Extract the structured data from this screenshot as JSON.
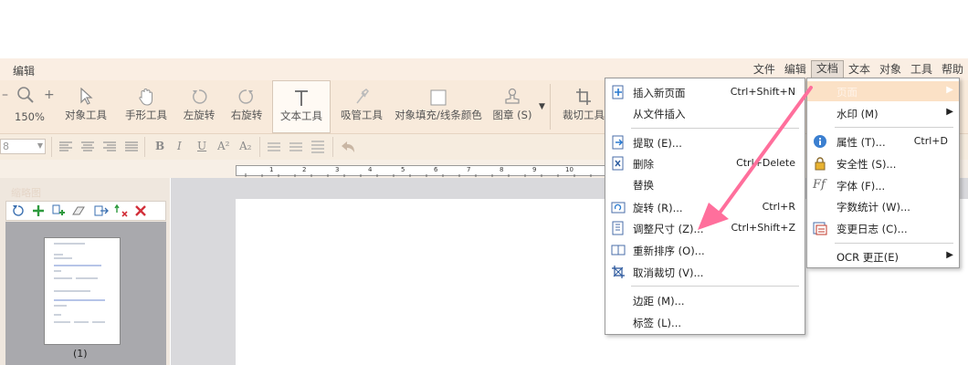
{
  "app": {
    "title": "编辑"
  },
  "menubar": {
    "items": [
      "文件",
      "编辑",
      "文档",
      "文本",
      "对象",
      "工具",
      "帮助"
    ],
    "active_index": 2
  },
  "ribbon": {
    "zoom_minus": "–",
    "zoom_plus": "+",
    "zoom_level": "150%",
    "tools": [
      "对象工具",
      "手形工具",
      "左旋转",
      "右旋转",
      "文本工具",
      "吸管工具",
      "对象填充/线条颜色",
      "图章 (S)",
      "裁切工具"
    ]
  },
  "format": {
    "font_size": "8",
    "bold": "B",
    "italic": "I",
    "underline": "U",
    "superscript": "A²",
    "subscript": "A₂"
  },
  "ruler": {
    "labels": [
      "1",
      "2",
      "3",
      "4",
      "5",
      "6",
      "7",
      "8",
      "9",
      "10"
    ]
  },
  "thumbnails": {
    "title": "缩略图",
    "page_label": "(1)"
  },
  "document_menu": {
    "items": [
      {
        "label": "插入新页面",
        "shortcut": "Ctrl+Shift+N",
        "icon": "insert-page-icon"
      },
      {
        "label": "从文件插入",
        "shortcut": "",
        "icon": ""
      },
      {
        "label": "提取 (E)...",
        "shortcut": "",
        "icon": "extract-icon"
      },
      {
        "label": "删除",
        "shortcut": "Ctrl+Delete",
        "icon": "delete-page-icon"
      },
      {
        "label": "替换",
        "shortcut": "",
        "icon": ""
      },
      {
        "label": "旋转 (R)...",
        "shortcut": "Ctrl+R",
        "icon": "rotate-page-icon"
      },
      {
        "label": "调整尺寸 (Z)...",
        "shortcut": "Ctrl+Shift+Z",
        "icon": "resize-icon"
      },
      {
        "label": "重新排序 (O)...",
        "shortcut": "",
        "icon": "reorder-icon"
      },
      {
        "label": "取消裁切 (V)...",
        "shortcut": "",
        "icon": "uncrop-icon"
      },
      {
        "label": "边距 (M)...",
        "shortcut": "",
        "icon": ""
      },
      {
        "label": "标签 (L)...",
        "shortcut": "",
        "icon": ""
      }
    ]
  },
  "submenu": {
    "items": [
      {
        "label": "页面",
        "shortcut": "",
        "arrow": "▶",
        "highlighted": true
      },
      {
        "label": "水印 (M)",
        "shortcut": "",
        "arrow": "▶"
      },
      {
        "label": "属性 (T)...",
        "shortcut": "Ctrl+D",
        "arrow": ""
      },
      {
        "label": "安全性 (S)...",
        "shortcut": "",
        "arrow": ""
      },
      {
        "label": "字体 (F)...",
        "shortcut": "",
        "arrow": ""
      },
      {
        "label": "字数统计 (W)...",
        "shortcut": "",
        "arrow": ""
      },
      {
        "label": "变更日志 (C)...",
        "shortcut": "",
        "arrow": ""
      },
      {
        "label": "OCR 更正(E)",
        "shortcut": "",
        "arrow": "▶"
      }
    ]
  },
  "colors": {
    "accent": "#ff6f9c",
    "ribbon": "#f8eadb",
    "highlight": "#fbe1c6"
  }
}
